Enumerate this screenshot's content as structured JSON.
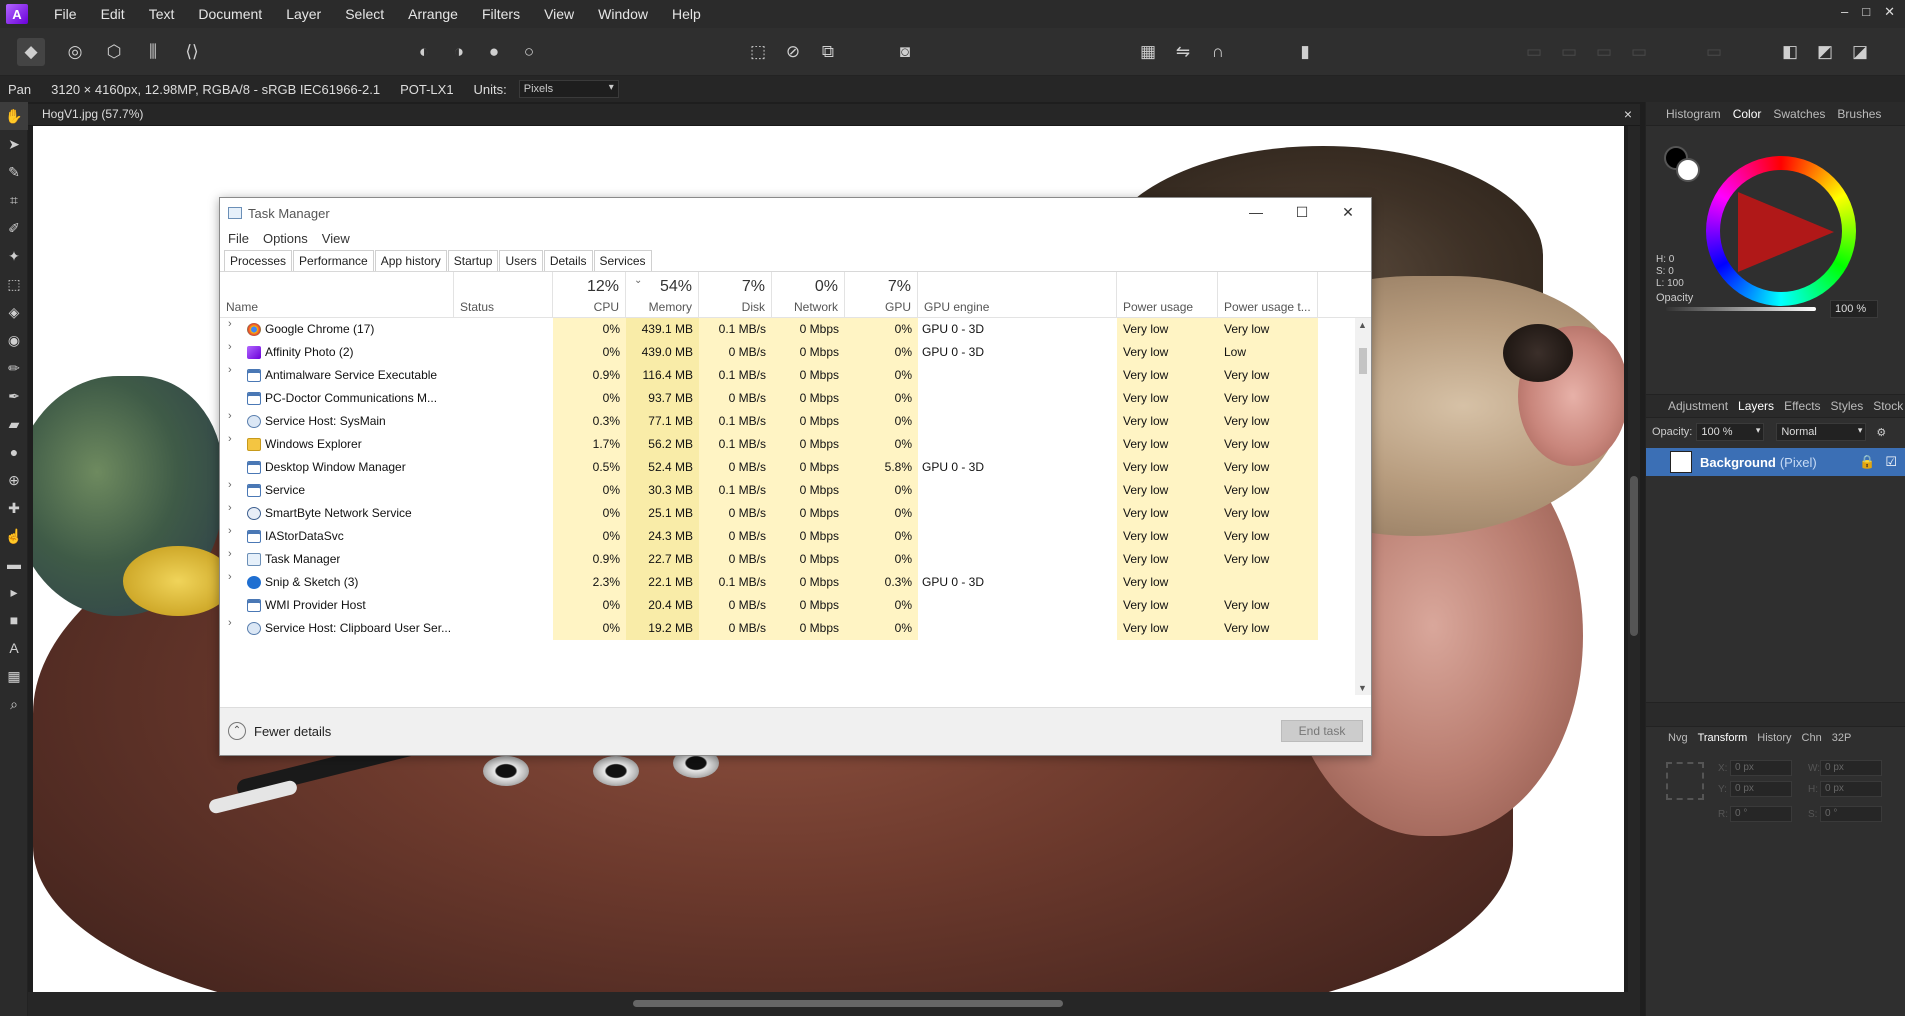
{
  "app": {
    "menu": [
      "File",
      "Edit",
      "Text",
      "Document",
      "Layer",
      "Select",
      "Arrange",
      "Filters",
      "View",
      "Window",
      "Help"
    ],
    "window_controls": [
      "–",
      "□",
      "✕"
    ]
  },
  "context_bar": {
    "tool": "Pan",
    "image_info": "3120 × 4160px, 12.98MP, RGBA/8 - sRGB IEC61966-2.1",
    "camera": "POT-LX1",
    "units_label": "Units:",
    "units_value": "Pixels"
  },
  "document": {
    "tab_title": "HogV1.jpg (57.7%)",
    "close": "×"
  },
  "right_panel": {
    "top_tabs": [
      "Histogram",
      "Color",
      "Swatches",
      "Brushes"
    ],
    "active_top_tab": "Color",
    "hsl": {
      "h": "H: 0",
      "s": "S: 0",
      "l": "L: 100"
    },
    "opacity_label": "Opacity",
    "opacity_value": "100 %",
    "layer_tabs": [
      "Adjustment",
      "Layers",
      "Effects",
      "Styles",
      "Stock"
    ],
    "active_layer_tab": "Layers",
    "layer_opacity_label": "Opacity:",
    "layer_opacity_value": "100 %",
    "blend_mode": "Normal",
    "layer_name": "Background",
    "layer_type": "(Pixel)",
    "bottom_tabs": [
      "Nvg",
      "Transform",
      "History",
      "Chn",
      "32P"
    ],
    "active_bottom_tab": "Transform",
    "transform": {
      "x": "0 px",
      "y": "0 px",
      "w": "0 px",
      "h": "0 px",
      "r": "0 °",
      "s": "0 °",
      "x_label": "X:",
      "y_label": "Y:",
      "w_label": "W:",
      "h_label": "H:",
      "r_label": "R:",
      "s_label": "S:"
    }
  },
  "task_manager": {
    "title": "Task Manager",
    "menu": [
      "File",
      "Options",
      "View"
    ],
    "tabs": [
      "Processes",
      "Performance",
      "App history",
      "Startup",
      "Users",
      "Details",
      "Services"
    ],
    "active_tab": "Processes",
    "columns": {
      "name": "Name",
      "status": "Status",
      "cpu": {
        "pct": "12%",
        "label": "CPU"
      },
      "memory": {
        "pct": "54%",
        "label": "Memory"
      },
      "disk": {
        "pct": "7%",
        "label": "Disk"
      },
      "network": {
        "pct": "0%",
        "label": "Network"
      },
      "gpu": {
        "pct": "7%",
        "label": "GPU"
      },
      "gpu_engine": "GPU engine",
      "power": "Power usage",
      "power_trend": "Power usage t..."
    },
    "processes": [
      {
        "name": "Google Chrome (17)",
        "expand": true,
        "icon": "chrome",
        "status": "",
        "cpu": "0%",
        "mem": "439.1 MB",
        "disk": "0.1 MB/s",
        "net": "0 Mbps",
        "gpu": "0%",
        "engine": "GPU 0 - 3D",
        "power": "Very low",
        "trend": "Very low"
      },
      {
        "name": "Affinity Photo (2)",
        "expand": true,
        "icon": "affinity",
        "status": "",
        "cpu": "0%",
        "mem": "439.0 MB",
        "disk": "0 MB/s",
        "net": "0 Mbps",
        "gpu": "0%",
        "engine": "GPU 0 - 3D",
        "power": "Very low",
        "trend": "Low"
      },
      {
        "name": "Antimalware Service Executable",
        "expand": true,
        "icon": "window",
        "status": "",
        "cpu": "0.9%",
        "mem": "116.4 MB",
        "disk": "0.1 MB/s",
        "net": "0 Mbps",
        "gpu": "0%",
        "engine": "",
        "power": "Very low",
        "trend": "Very low"
      },
      {
        "name": "PC-Doctor Communications M...",
        "expand": false,
        "icon": "window",
        "status": "",
        "cpu": "0%",
        "mem": "93.7 MB",
        "disk": "0 MB/s",
        "net": "0 Mbps",
        "gpu": "0%",
        "engine": "",
        "power": "Very low",
        "trend": "Very low"
      },
      {
        "name": "Service Host: SysMain",
        "expand": true,
        "icon": "gear",
        "status": "",
        "cpu": "0.3%",
        "mem": "77.1 MB",
        "disk": "0.1 MB/s",
        "net": "0 Mbps",
        "gpu": "0%",
        "engine": "",
        "power": "Very low",
        "trend": "Very low"
      },
      {
        "name": "Windows Explorer",
        "expand": true,
        "icon": "folder",
        "status": "",
        "cpu": "1.7%",
        "mem": "56.2 MB",
        "disk": "0.1 MB/s",
        "net": "0 Mbps",
        "gpu": "0%",
        "engine": "",
        "power": "Very low",
        "trend": "Very low"
      },
      {
        "name": "Desktop Window Manager",
        "expand": false,
        "icon": "window",
        "status": "",
        "cpu": "0.5%",
        "mem": "52.4 MB",
        "disk": "0 MB/s",
        "net": "0 Mbps",
        "gpu": "5.8%",
        "engine": "GPU 0 - 3D",
        "power": "Very low",
        "trend": "Very low"
      },
      {
        "name": "Service",
        "expand": true,
        "icon": "window",
        "status": "",
        "cpu": "0%",
        "mem": "30.3 MB",
        "disk": "0.1 MB/s",
        "net": "0 Mbps",
        "gpu": "0%",
        "engine": "",
        "power": "Very low",
        "trend": "Very low"
      },
      {
        "name": "SmartByte Network Service",
        "expand": true,
        "icon": "globe",
        "status": "",
        "cpu": "0%",
        "mem": "25.1 MB",
        "disk": "0 MB/s",
        "net": "0 Mbps",
        "gpu": "0%",
        "engine": "",
        "power": "Very low",
        "trend": "Very low"
      },
      {
        "name": "IAStorDataSvc",
        "expand": true,
        "icon": "window",
        "status": "",
        "cpu": "0%",
        "mem": "24.3 MB",
        "disk": "0 MB/s",
        "net": "0 Mbps",
        "gpu": "0%",
        "engine": "",
        "power": "Very low",
        "trend": "Very low"
      },
      {
        "name": "Task Manager",
        "expand": true,
        "icon": "taskmgr",
        "status": "",
        "cpu": "0.9%",
        "mem": "22.7 MB",
        "disk": "0 MB/s",
        "net": "0 Mbps",
        "gpu": "0%",
        "engine": "",
        "power": "Very low",
        "trend": "Very low"
      },
      {
        "name": "Snip & Sketch (3)",
        "expand": true,
        "icon": "snip",
        "status": "leaf",
        "cpu": "2.3%",
        "mem": "22.1 MB",
        "disk": "0.1 MB/s",
        "net": "0 Mbps",
        "gpu": "0.3%",
        "engine": "GPU 0 - 3D",
        "power": "Very low",
        "trend": ""
      },
      {
        "name": "WMI Provider Host",
        "expand": false,
        "icon": "window",
        "status": "",
        "cpu": "0%",
        "mem": "20.4 MB",
        "disk": "0 MB/s",
        "net": "0 Mbps",
        "gpu": "0%",
        "engine": "",
        "power": "Very low",
        "trend": "Very low"
      },
      {
        "name": "Service Host: Clipboard User Ser...",
        "expand": true,
        "icon": "gear",
        "status": "",
        "cpu": "0%",
        "mem": "19.2 MB",
        "disk": "0 MB/s",
        "net": "0 Mbps",
        "gpu": "0%",
        "engine": "",
        "power": "Very low",
        "trend": "Very low"
      }
    ],
    "fewer_details": "Fewer details",
    "end_task": "End task"
  },
  "colors": {
    "accent": "#3b6fb5",
    "heat_light": "#fff4c4",
    "heat_dark": "#f9eca8"
  }
}
